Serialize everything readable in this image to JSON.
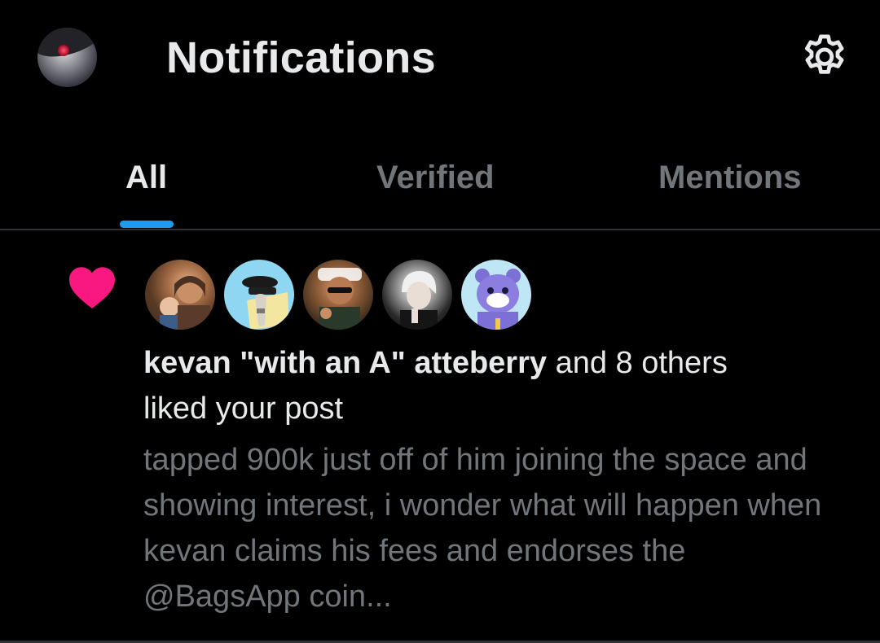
{
  "header": {
    "title": "Notifications",
    "settings_icon": "gear-icon",
    "avatar_icon": "profile-avatar"
  },
  "tabs": [
    {
      "label": "All",
      "active": true
    },
    {
      "label": "Verified",
      "active": false
    },
    {
      "label": "Mentions",
      "active": false
    }
  ],
  "colors": {
    "accent": "#1d9bf0",
    "like": "#f91880",
    "muted_text": "#71767b",
    "primary_text": "#e7e9ea",
    "background": "#000000"
  },
  "notification": {
    "type_icon": "heart-icon",
    "actor": "kevan \"with an A\" atteberry",
    "others": " and 8 others",
    "action": "liked your post",
    "post_text": "tapped 900k just off of him joining the space and showing interest, i wonder what will happen when kevan claims his fees and endorses the @BagsApp coin..."
  }
}
